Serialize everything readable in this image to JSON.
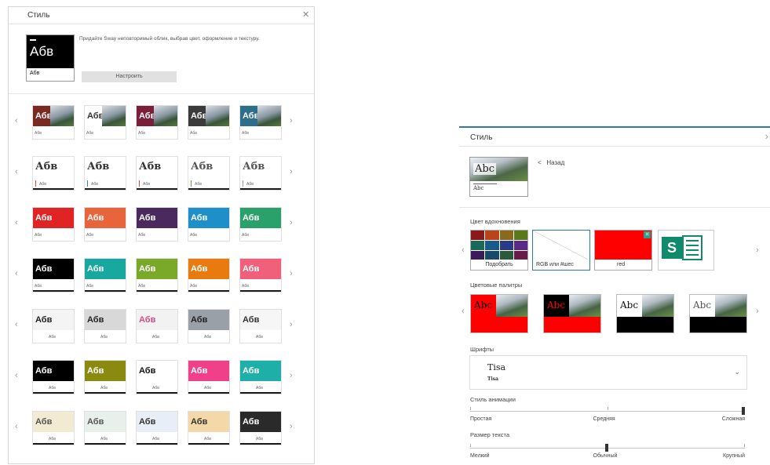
{
  "left_panel": {
    "title": "Стиль",
    "preview_big": "Абв",
    "preview_small": "Абв",
    "description": "Придайте Sway неповторимый облик, выбрав цвет, оформление и текстуру.",
    "customize_label": "Настроить",
    "thumb_text": "Абв",
    "thumb_small": "Абв",
    "rows": [
      [
        {
          "t": "#7a2a20",
          "c": "#fff"
        },
        {
          "t": "#ffffff",
          "c": "#333"
        },
        {
          "t": "#7a1e3a",
          "c": "#fff"
        },
        {
          "t": "#3b3b3b",
          "c": "#fff"
        },
        {
          "t": "#2d6e8a",
          "c": "#fff"
        }
      ],
      [
        {
          "t": "#ffffff",
          "c": "#333",
          "a": "#e04a3a"
        },
        {
          "t": "#ffffff",
          "c": "#333",
          "a": "#3a7abf"
        },
        {
          "t": "#ffffff",
          "c": "#333",
          "a": "#e04a3a"
        },
        {
          "t": "#ffffff",
          "c": "#555",
          "a": "#6aa83a"
        },
        {
          "t": "#ffffff",
          "c": "#555",
          "a": "#999"
        }
      ],
      [
        {
          "t": "#e02424",
          "c": "#fff"
        },
        {
          "t": "#e8643a",
          "c": "#fff"
        },
        {
          "t": "#4a2a5e",
          "c": "#fff"
        },
        {
          "t": "#1e8fc8",
          "c": "#fff"
        },
        {
          "t": "#2aa06a",
          "c": "#fff"
        }
      ],
      [
        {
          "t": "#000000",
          "c": "#fff"
        },
        {
          "t": "#19a8a0",
          "c": "#fff"
        },
        {
          "t": "#7aa828",
          "c": "#fff"
        },
        {
          "t": "#e87a10",
          "c": "#fff"
        },
        {
          "t": "#f0607a",
          "c": "#fff"
        }
      ],
      [
        {
          "t": "#f4f4f4",
          "c": "#222"
        },
        {
          "t": "#d8d8d8",
          "c": "#222"
        },
        {
          "t": "#f2f2f2",
          "c": "#d84a8a"
        },
        {
          "t": "#9aa0a8",
          "c": "#222"
        },
        {
          "t": "#f6f6f6",
          "c": "#333"
        }
      ],
      [
        {
          "t": "#000000",
          "c": "#fff"
        },
        {
          "t": "#8a8a10",
          "c": "#fff"
        },
        {
          "t": "#ffffff",
          "c": "#111"
        },
        {
          "t": "#f0408a",
          "c": "#fff"
        },
        {
          "t": "#1eb0a8",
          "c": "#fff"
        }
      ],
      [
        {
          "t": "#f2ead2",
          "c": "#555"
        },
        {
          "t": "#e8f0ec",
          "c": "#555"
        },
        {
          "t": "#e8eef8",
          "c": "#333"
        },
        {
          "t": "#f4d8a8",
          "c": "#333"
        },
        {
          "t": "#2a2a2a",
          "c": "#fff"
        }
      ]
    ]
  },
  "right_panel": {
    "title": "Стиль",
    "preview_title": "Abc",
    "preview_sub": "Abc",
    "back_label": "Назад",
    "inspiration_label": "Цвет вдохновения",
    "swatches": {
      "pick_label": "Подобрать",
      "rgb_label": "RGB или #шес",
      "red_label": "red"
    },
    "mosaic_colors": [
      "#8a1a1a",
      "#b8441a",
      "#8a6a1a",
      "#5a7a1a",
      "#1a6a5a",
      "#1a5a8a",
      "#2a3a8a",
      "#5a2a8a",
      "#3a1a5a",
      "#1a4a6a",
      "#2a5a3a",
      "#6a1a4a"
    ],
    "palettes_label": "Цветовые палитры",
    "palettes": [
      {
        "top": "#ff0000",
        "bot": "#ff0000",
        "txt": "#000",
        "text": "Abc"
      },
      {
        "top": "#000000",
        "bot": "#ff0000",
        "txt": "#ff0000",
        "text": "Abc"
      },
      {
        "top": "#ffffff",
        "bot": "#000000",
        "txt": "#111",
        "text": "Abc"
      },
      {
        "top": "#ffffff",
        "bot": "#000000",
        "txt": "#555",
        "text": "Abc"
      }
    ],
    "fonts_label": "Шрифты",
    "font_name": "Tisa",
    "font_sample": "Tisa",
    "animation_label": "Стиль анимации",
    "animation_ticks": [
      "Простая",
      "Средняя",
      "Сложная"
    ],
    "animation_value": 1.0,
    "textsize_label": "Размер текста",
    "textsize_ticks": [
      "Мелкий",
      "Обычный",
      "Крупный"
    ],
    "textsize_value": 0.5
  }
}
